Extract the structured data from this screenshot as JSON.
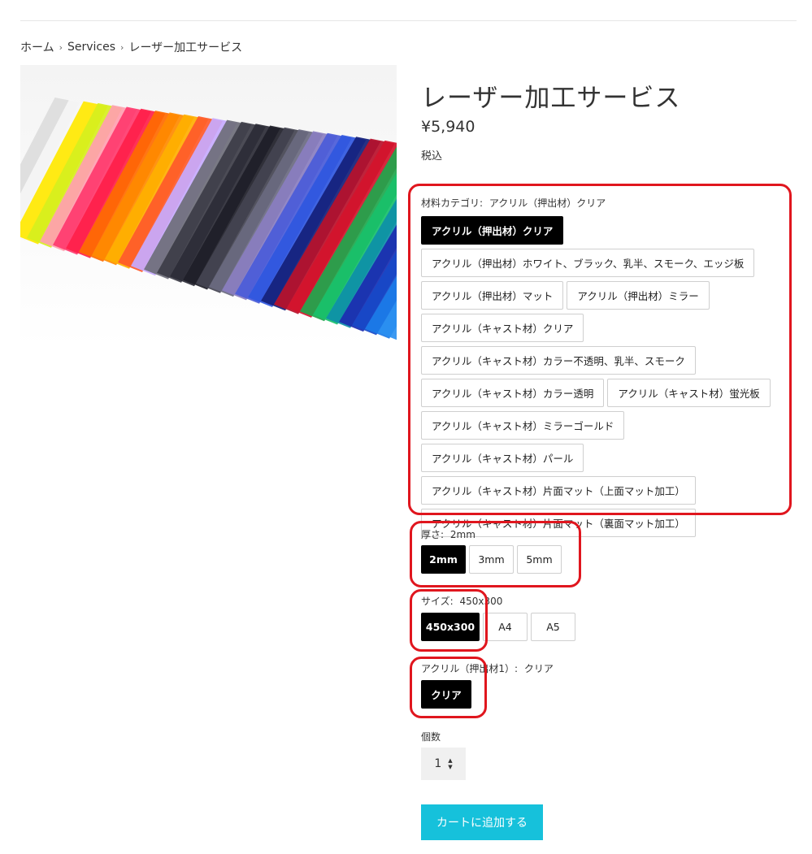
{
  "breadcrumb": {
    "home": "ホーム",
    "services": "Services",
    "current": "レーザー加工サービス",
    "separator": "›"
  },
  "product": {
    "title": "レーザー加工サービス",
    "price": "¥5,940",
    "tax_note": "税込"
  },
  "material": {
    "label": "材料カテゴリ:",
    "selected": "アクリル（押出材）クリア",
    "options": [
      "アクリル（押出材）クリア",
      "アクリル（押出材）ホワイト、ブラック、乳半、スモーク、エッジ板",
      "アクリル（押出材）マット",
      "アクリル（押出材）ミラー",
      "アクリル（キャスト材）クリア",
      "アクリル（キャスト材）カラー不透明、乳半、スモーク",
      "アクリル（キャスト材）カラー透明",
      "アクリル（キャスト材）蛍光板",
      "アクリル（キャスト材）ミラーゴールド",
      "アクリル（キャスト材）パール",
      "アクリル（キャスト材）片面マット（上面マット加工）",
      "アクリル（キャスト材）片面マット（裏面マット加工）"
    ]
  },
  "thickness": {
    "label": "厚さ:",
    "selected": "2mm",
    "options": [
      "2mm",
      "3mm",
      "5mm"
    ]
  },
  "size": {
    "label": "サイズ:",
    "selected": "450x300",
    "options": [
      "450x300",
      "A4",
      "A5"
    ]
  },
  "acrylic": {
    "label": "アクリル（押出材1）:",
    "selected": "クリア",
    "options": [
      "クリア"
    ]
  },
  "quantity": {
    "label": "個数",
    "value": "1",
    "up": "▲",
    "down": "▼"
  },
  "cart": {
    "button": "カートに追加する"
  },
  "colors": {
    "accent": "#16c1db",
    "selected_bg": "#000000",
    "highlight": "#e0161e"
  }
}
